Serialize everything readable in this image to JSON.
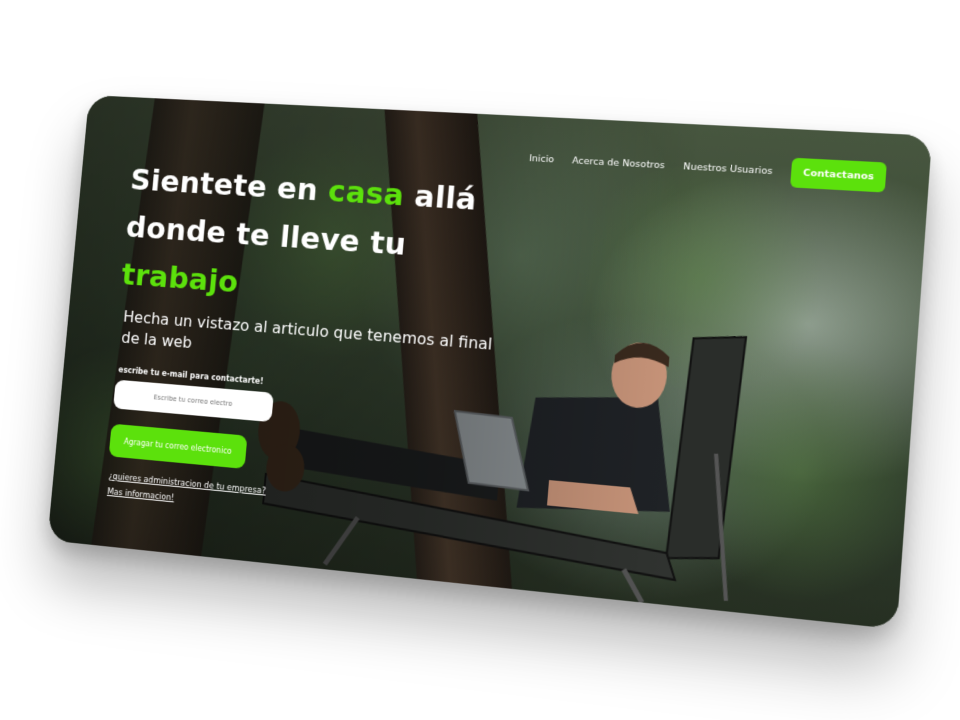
{
  "nav": {
    "links": [
      "Inicio",
      "Acerca de Nosotros",
      "Nuestros Usuarios"
    ],
    "cta": "Contactanos"
  },
  "hero": {
    "headline_part1": "Sientete en ",
    "headline_accent1": "casa",
    "headline_part2": " allá donde te lleve tu",
    "headline_accent2": "trabajo",
    "subtitle": "Hecha un vistazo al articulo que tenemos al final de la web",
    "email_label": "escribe tu e-mail para contactarte!",
    "email_placeholder": "Escribe tu correo electro",
    "submit_label": "Agragar tu correo electronico",
    "link_admin": "¿quieres administracion de tu empresa?",
    "link_more": "Mas informacion!"
  },
  "colors": {
    "accent": "#5ce10c",
    "text": "#ffffff"
  }
}
